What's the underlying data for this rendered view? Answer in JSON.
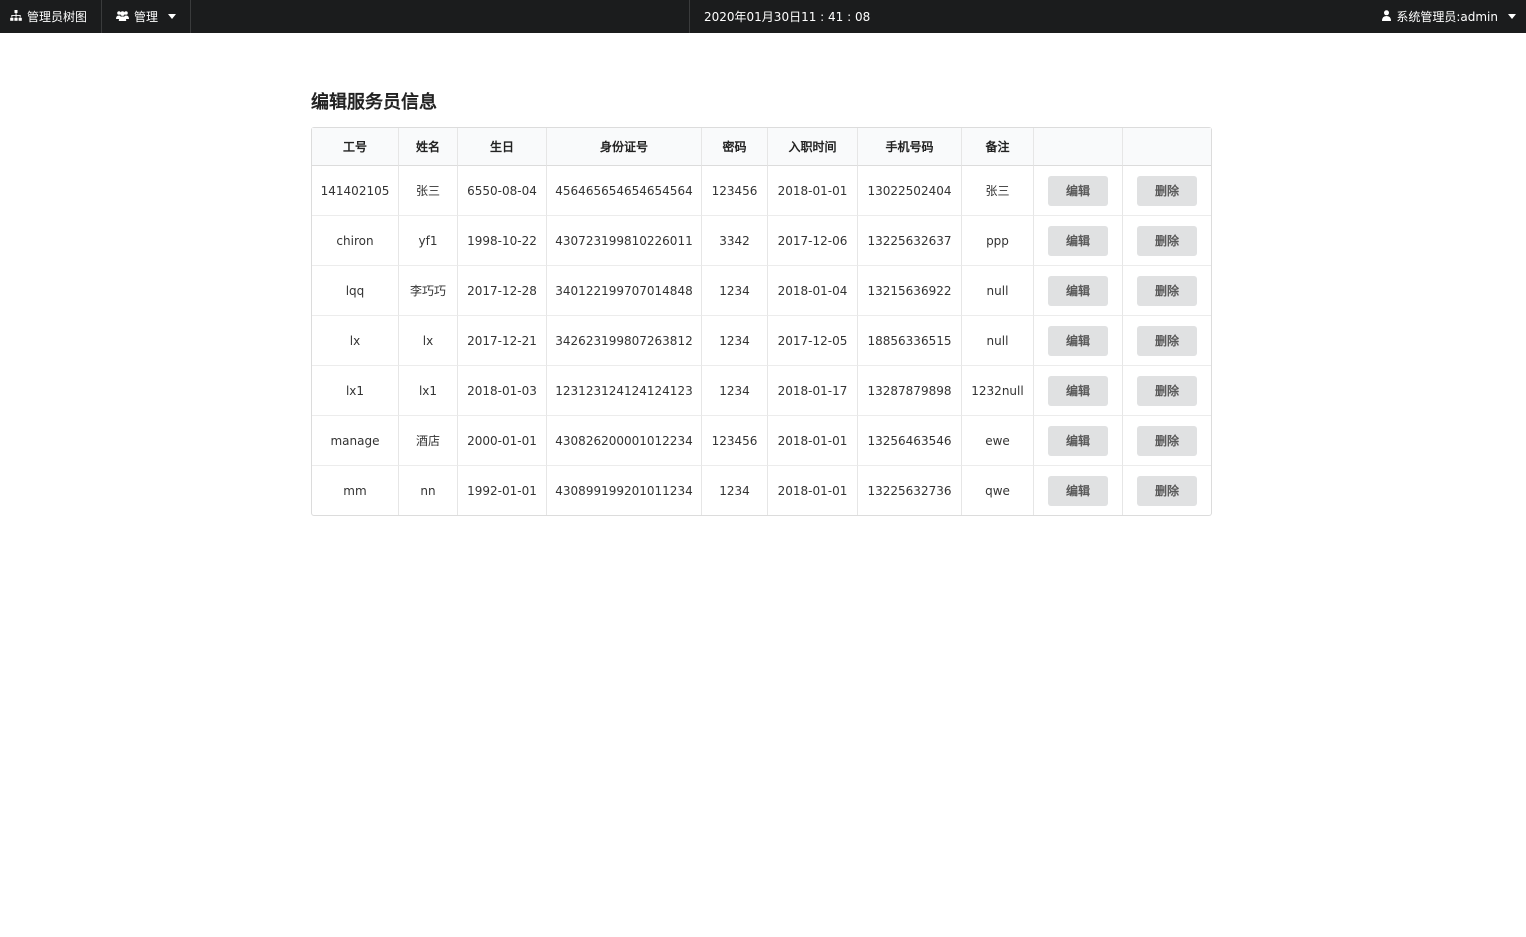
{
  "topbar": {
    "tree_label": "管理员树图",
    "manage_label": "管理",
    "datetime": "2020年01月30日11 : 41 : 08",
    "user_label": "系统管理员:admin",
    "icons": {
      "tree": "sitemap-icon",
      "manage": "users-icon",
      "user": "user-icon"
    }
  },
  "page": {
    "title": "编辑服务员信息"
  },
  "table": {
    "headers": [
      "工号",
      "姓名",
      "生日",
      "身份证号",
      "密码",
      "入职时间",
      "手机号码",
      "备注",
      "",
      ""
    ],
    "edit_label": "编辑",
    "delete_label": "删除",
    "rows": [
      [
        "141402105",
        "张三",
        "6550-08-04",
        "456465654654654564",
        "123456",
        "2018-01-01",
        "13022502404",
        "张三"
      ],
      [
        "chiron",
        "yf1",
        "1998-10-22",
        "430723199810226011",
        "3342",
        "2017-12-06",
        "13225632637",
        "ppp"
      ],
      [
        "lqq",
        "李巧巧",
        "2017-12-28",
        "340122199707014848",
        "1234",
        "2018-01-04",
        "13215636922",
        "null"
      ],
      [
        "lx",
        "lx",
        "2017-12-21",
        "342623199807263812",
        "1234",
        "2017-12-05",
        "18856336515",
        "null"
      ],
      [
        "lx1",
        "lx1",
        "2018-01-03",
        "123123124124124123",
        "1234",
        "2018-01-17",
        "13287879898",
        "1232null"
      ],
      [
        "manage",
        "酒店",
        "2000-01-01",
        "430826200001012234",
        "123456",
        "2018-01-01",
        "13256463546",
        "ewe"
      ],
      [
        "mm",
        "nn",
        "1992-01-01",
        "430899199201011234",
        "1234",
        "2018-01-01",
        "13225632736",
        "qwe"
      ]
    ]
  }
}
